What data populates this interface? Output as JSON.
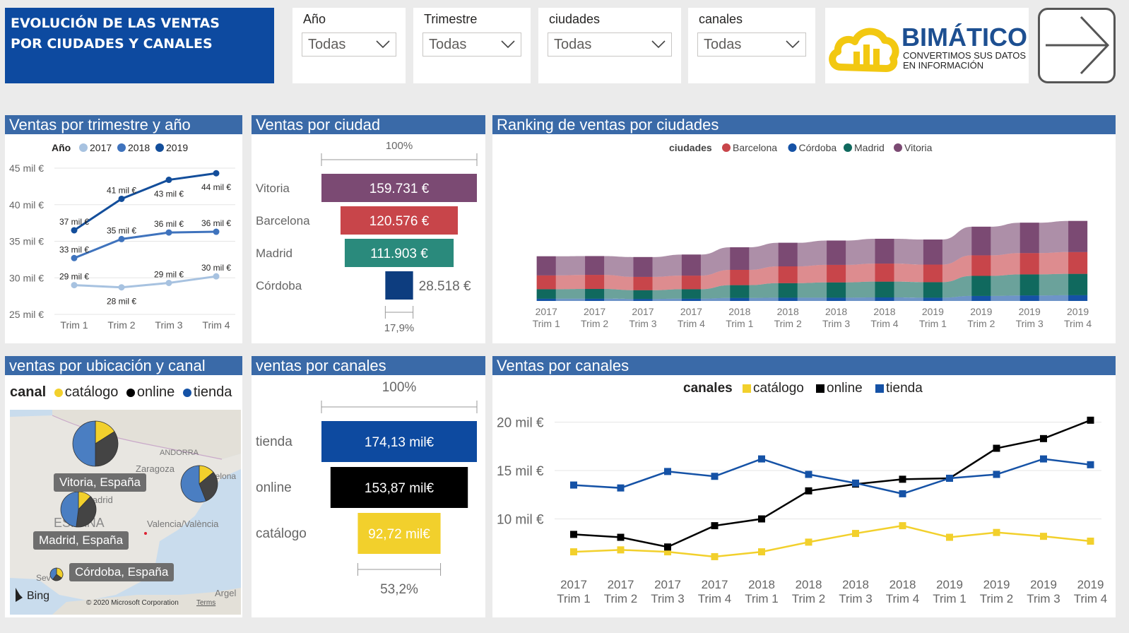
{
  "header": {
    "title_line1": "EVOLUCIÓN DE LAS VENTAS",
    "title_line2": "POR CIUDADES Y CANALES"
  },
  "slicers": [
    {
      "label": "Año",
      "value": "Todas"
    },
    {
      "label": "Trimestre",
      "value": "Todas"
    },
    {
      "label": "ciudades",
      "value": "Todas"
    },
    {
      "label": "canales",
      "value": "Todas"
    }
  ],
  "logo": {
    "name": "BIMÁTICO",
    "tagline1": "CONVERTIMOS SUS DATOS",
    "tagline2": "EN INFORMACIÓN",
    "color_name": "#1d4f91",
    "color_cloud": "#f2c811"
  },
  "nav": {
    "icon": "arrow-right-icon"
  },
  "panels": {
    "p1_title": "Ventas por trimestre y año",
    "p2_title": "Ventas por ciudad",
    "p3_title": "Ranking de ventas por ciudades",
    "p4_title": "ventas por ubicación y canal",
    "p5_title": "ventas por canales",
    "p6_title": "Ventas por canales"
  },
  "map": {
    "legend_title": "canal",
    "legend_items": [
      "catálogo",
      "online",
      "tienda"
    ],
    "place_labels": [
      "ANDORRA",
      "Zaragoza",
      "Barcelona",
      "Valencia/València",
      "ESPAÑA",
      "Madrid",
      "Sev",
      "Argel"
    ],
    "labels": [
      "Vitoria, España",
      "Madrid, España",
      "Córdoba, España"
    ],
    "attribution": "© 2020 Microsoft Corporation",
    "terms": "Terms",
    "bing": "Bing",
    "pies": [
      {
        "city": "Vitoria",
        "catalogo": 0.16,
        "online": 0.34,
        "tienda": 0.5
      },
      {
        "city": "Barcelona",
        "catalogo": 0.14,
        "online": 0.3,
        "tienda": 0.56
      },
      {
        "city": "Madrid",
        "catalogo": 0.12,
        "online": 0.4,
        "tienda": 0.48
      },
      {
        "city": "Córdoba",
        "catalogo": 0.35,
        "online": 0.25,
        "tienda": 0.4
      }
    ]
  },
  "chart_data": [
    {
      "id": "trimestre_anio",
      "type": "line",
      "legend_title": "Año",
      "categories": [
        "Trim 1",
        "Trim 2",
        "Trim 3",
        "Trim 4"
      ],
      "y_ticks": [
        "45 mil €",
        "40 mil €",
        "35 mil €",
        "30 mil €",
        "25 mil €"
      ],
      "ylim": [
        25,
        45
      ],
      "series": [
        {
          "name": "2017",
          "color": "#a7c2e0",
          "values": [
            29,
            28.7,
            29.3,
            30.2
          ],
          "labels": [
            "29 mil €",
            "28 mil €",
            "29 mil €",
            "30 mil €"
          ]
        },
        {
          "name": "2018",
          "color": "#3f73bd",
          "values": [
            32.7,
            35.3,
            36.2,
            36.3
          ],
          "labels": [
            "33 mil €",
            "35 mil €",
            "36 mil €",
            "36 mil €"
          ]
        },
        {
          "name": "2019",
          "color": "#134e9b",
          "values": [
            36.5,
            40.8,
            43.4,
            44.3
          ],
          "labels": [
            "37 mil €",
            "41 mil €",
            "43 mil €",
            "44 mil €"
          ]
        }
      ]
    },
    {
      "id": "ventas_ciudad",
      "type": "bar",
      "top_label": "100%",
      "bottom_label": "17,9%",
      "categories": [
        "Vitoria",
        "Barcelona",
        "Madrid",
        "Córdoba"
      ],
      "values": [
        159731,
        120576,
        111903,
        28518
      ],
      "value_labels": [
        "159.731 €",
        "120.576 €",
        "111.903 €",
        "28.518 €"
      ],
      "colors": [
        "#7b4a73",
        "#c8454a",
        "#2a8a7c",
        "#0d3d7f"
      ]
    },
    {
      "id": "ranking_ciudades",
      "type": "area",
      "legend_title": "ciudades",
      "legend": [
        "Barcelona",
        "Córdoba",
        "Madrid",
        "Vitoria"
      ],
      "legend_colors": [
        "#c8454a",
        "#1552a6",
        "#10695e",
        "#7b4a73"
      ],
      "categories": [
        [
          "2017",
          "Trim 1"
        ],
        [
          "2017",
          "Trim 2"
        ],
        [
          "2017",
          "Trim 3"
        ],
        [
          "2017",
          "Trim 4"
        ],
        [
          "2018",
          "Trim 1"
        ],
        [
          "2018",
          "Trim 2"
        ],
        [
          "2018",
          "Trim 3"
        ],
        [
          "2018",
          "Trim 4"
        ],
        [
          "2019",
          "Trim 1"
        ],
        [
          "2019",
          "Trim 2"
        ],
        [
          "2019",
          "Trim 3"
        ],
        [
          "2019",
          "Trim 4"
        ]
      ],
      "series": [
        {
          "name": "Córdoba",
          "values": [
            0.9,
            0.9,
            0.8,
            0.9,
            1.2,
            1.3,
            1.3,
            1.4,
            1.3,
            2.0,
            2.2,
            2.3
          ]
        },
        {
          "name": "Madrid",
          "values": [
            3.8,
            3.9,
            3.5,
            3.8,
            5.1,
            5.8,
            6.1,
            6.3,
            6.2,
            8.0,
            8.4,
            8.5
          ]
        },
        {
          "name": "Barcelona",
          "values": [
            5.5,
            5.6,
            5.3,
            5.4,
            6.1,
            6.7,
            7.0,
            7.2,
            7.0,
            8.2,
            8.5,
            8.7
          ]
        },
        {
          "name": "Vitoria",
          "values": [
            7.6,
            7.5,
            7.9,
            8.4,
            9.0,
            9.4,
            9.7,
            9.9,
            10.0,
            11.4,
            12.1,
            12.4
          ]
        }
      ]
    },
    {
      "id": "ventas_canales_bar",
      "type": "bar",
      "top_label": "100%",
      "bottom_label": "53,2%",
      "categories": [
        "tienda",
        "online",
        "catálogo"
      ],
      "values": [
        174.13,
        153.87,
        92.72
      ],
      "value_labels": [
        "174,13 mil€",
        "153,87 mil€",
        "92,72 mil€"
      ],
      "colors": [
        "#0d4aa0",
        "#000000",
        "#f2d02c"
      ]
    },
    {
      "id": "ventas_canales_line",
      "type": "line",
      "legend_title": "canales",
      "categories": [
        [
          "2017",
          "Trim 1"
        ],
        [
          "2017",
          "Trim 2"
        ],
        [
          "2017",
          "Trim 3"
        ],
        [
          "2017",
          "Trim 4"
        ],
        [
          "2018",
          "Trim 1"
        ],
        [
          "2018",
          "Trim 2"
        ],
        [
          "2018",
          "Trim 3"
        ],
        [
          "2018",
          "Trim 4"
        ],
        [
          "2019",
          "Trim 1"
        ],
        [
          "2019",
          "Trim 2"
        ],
        [
          "2019",
          "Trim 3"
        ],
        [
          "2019",
          "Trim 4"
        ]
      ],
      "y_ticks": [
        "20 mil €",
        "15 mil €",
        "10 mil €"
      ],
      "ylim": [
        5,
        21.5
      ],
      "series": [
        {
          "name": "catálogo",
          "color": "#f2d02c",
          "values": [
            6.6,
            6.8,
            6.6,
            6.1,
            6.6,
            7.6,
            8.5,
            9.3,
            8.1,
            8.6,
            8.2,
            7.7
          ]
        },
        {
          "name": "online",
          "color": "#000000",
          "values": [
            8.4,
            8.1,
            7.1,
            9.3,
            10.0,
            12.9,
            13.6,
            14.1,
            14.2,
            17.3,
            18.3,
            20.2
          ]
        },
        {
          "name": "tienda",
          "color": "#1552a6",
          "values": [
            13.5,
            13.2,
            14.9,
            14.4,
            16.2,
            14.6,
            13.7,
            12.6,
            14.2,
            14.6,
            16.2,
            15.6
          ]
        }
      ]
    }
  ]
}
